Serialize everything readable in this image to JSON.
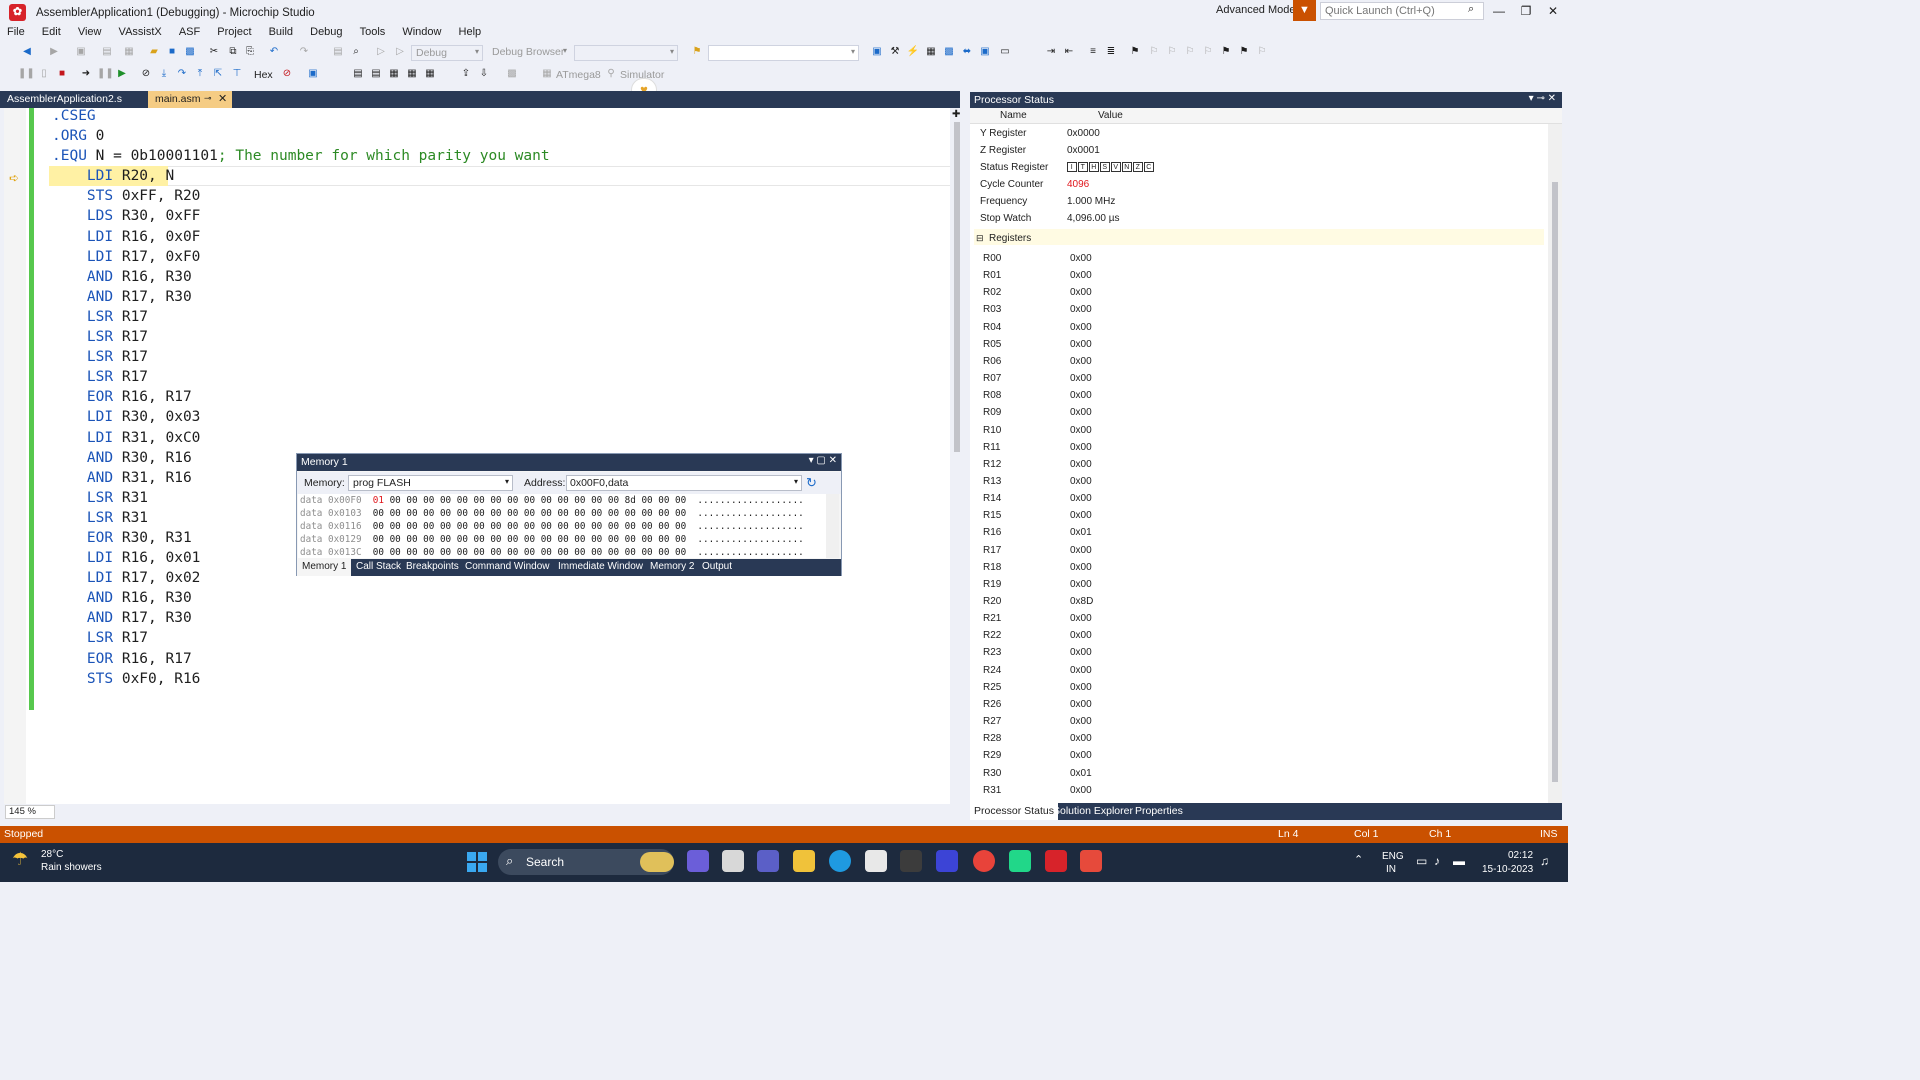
{
  "window": {
    "title": "AssemblerApplication1 (Debugging) - Microchip Studio",
    "advanced_mode": "Advanced Mode",
    "quick_launch_placeholder": "Quick Launch (Ctrl+Q)"
  },
  "menu": [
    "File",
    "Edit",
    "View",
    "VAssistX",
    "ASF",
    "Project",
    "Build",
    "Debug",
    "Tools",
    "Window",
    "Help"
  ],
  "toolbar": {
    "config_dropdown": "Debug",
    "browser_dropdown": "Debug Browser",
    "hex_label": "Hex",
    "device_label": "ATmega8",
    "tool_label": "Simulator"
  },
  "tabs": {
    "file1": "AssemblerApplication2.s",
    "file2": "main.asm"
  },
  "editor": {
    "zoom": "145 %",
    "lines": [
      {
        "kw": ".CSEG",
        "rest": "",
        "comment": ""
      },
      {
        "kw": ".ORG",
        "rest": " 0",
        "comment": ""
      },
      {
        "kw": ".EQU",
        "rest": " N = 0b10001101",
        "comment": "; The number for which parity you want"
      },
      {
        "kw": "    LDI",
        "rest": " R20, N",
        "comment": ""
      },
      {
        "kw": "    STS",
        "rest": " 0xFF, R20",
        "comment": ""
      },
      {
        "kw": "    LDS",
        "rest": " R30, 0xFF",
        "comment": ""
      },
      {
        "kw": "    LDI",
        "rest": " R16, 0x0F",
        "comment": ""
      },
      {
        "kw": "    LDI",
        "rest": " R17, 0xF0",
        "comment": ""
      },
      {
        "kw": "    AND",
        "rest": " R16, R30",
        "comment": ""
      },
      {
        "kw": "    AND",
        "rest": " R17, R30",
        "comment": ""
      },
      {
        "kw": "    LSR",
        "rest": " R17",
        "comment": ""
      },
      {
        "kw": "    LSR",
        "rest": " R17",
        "comment": ""
      },
      {
        "kw": "    LSR",
        "rest": " R17",
        "comment": ""
      },
      {
        "kw": "    LSR",
        "rest": " R17",
        "comment": ""
      },
      {
        "kw": "    EOR",
        "rest": " R16, R17",
        "comment": ""
      },
      {
        "kw": "    LDI",
        "rest": " R30, 0x03",
        "comment": ""
      },
      {
        "kw": "    LDI",
        "rest": " R31, 0xC0",
        "comment": ""
      },
      {
        "kw": "    AND",
        "rest": " R30, R16",
        "comment": ""
      },
      {
        "kw": "    AND",
        "rest": " R31, R16",
        "comment": ""
      },
      {
        "kw": "    LSR",
        "rest": " R31",
        "comment": ""
      },
      {
        "kw": "    LSR",
        "rest": " R31",
        "comment": ""
      },
      {
        "kw": "    EOR",
        "rest": " R30, R31",
        "comment": ""
      },
      {
        "kw": "    LDI",
        "rest": " R16, 0x01",
        "comment": ""
      },
      {
        "kw": "    LDI",
        "rest": " R17, 0x02",
        "comment": ""
      },
      {
        "kw": "    AND",
        "rest": " R16, R30",
        "comment": ""
      },
      {
        "kw": "    AND",
        "rest": " R17, R30",
        "comment": ""
      },
      {
        "kw": "    LSR",
        "rest": " R17",
        "comment": ""
      },
      {
        "kw": "    EOR",
        "rest": " R16, R17",
        "comment": ""
      },
      {
        "kw": "    STS",
        "rest": " 0xF0, R16",
        "comment": ""
      }
    ]
  },
  "memory": {
    "title": "Memory 1",
    "memory_label": "Memory:",
    "memory_value": "prog FLASH",
    "address_label": "Address:",
    "address_value": "0x00F0,data",
    "rows": [
      {
        "addr": "data 0x00F0",
        "first": "01",
        "rest": " 00 00 00 00 00 00 00 00 00 00 00 00 00 00 8d 00 00 00",
        "ascii": "  ..................."
      },
      {
        "addr": "data 0x0103",
        "first": "00",
        "rest": " 00 00 00 00 00 00 00 00 00 00 00 00 00 00 00 00 00 00",
        "ascii": "  ..................."
      },
      {
        "addr": "data 0x0116",
        "first": "00",
        "rest": " 00 00 00 00 00 00 00 00 00 00 00 00 00 00 00 00 00 00",
        "ascii": "  ..................."
      },
      {
        "addr": "data 0x0129",
        "first": "00",
        "rest": " 00 00 00 00 00 00 00 00 00 00 00 00 00 00 00 00 00 00",
        "ascii": "  ..................."
      },
      {
        "addr": "data 0x013C",
        "first": "00",
        "rest": " 00 00 00 00 00 00 00 00 00 00 00 00 00 00 00 00 00 00",
        "ascii": "  ..................."
      }
    ],
    "tabs": [
      "Memory 1",
      "Call Stack",
      "Breakpoints",
      "Command Window",
      "Immediate Window",
      "Memory 2",
      "Output"
    ]
  },
  "processor": {
    "title": "Processor Status",
    "col_name": "Name",
    "col_value": "Value",
    "rows": [
      {
        "name": "Y Register",
        "value": "0x0000"
      },
      {
        "name": "Z Register",
        "value": "0x0001"
      },
      {
        "name": "Status Register",
        "value": ""
      },
      {
        "name": "Cycle Counter",
        "value": "4096"
      },
      {
        "name": "Frequency",
        "value": "1.000 MHz"
      },
      {
        "name": "Stop Watch",
        "value": "4,096.00 µs"
      }
    ],
    "status_bits": [
      "I",
      "T",
      "H",
      "S",
      "V",
      "N",
      "Z",
      "C"
    ],
    "registers_label": "Registers",
    "registers": [
      {
        "name": "R00",
        "value": "0x00"
      },
      {
        "name": "R01",
        "value": "0x00"
      },
      {
        "name": "R02",
        "value": "0x00"
      },
      {
        "name": "R03",
        "value": "0x00"
      },
      {
        "name": "R04",
        "value": "0x00"
      },
      {
        "name": "R05",
        "value": "0x00"
      },
      {
        "name": "R06",
        "value": "0x00"
      },
      {
        "name": "R07",
        "value": "0x00"
      },
      {
        "name": "R08",
        "value": "0x00"
      },
      {
        "name": "R09",
        "value": "0x00"
      },
      {
        "name": "R10",
        "value": "0x00"
      },
      {
        "name": "R11",
        "value": "0x00"
      },
      {
        "name": "R12",
        "value": "0x00"
      },
      {
        "name": "R13",
        "value": "0x00"
      },
      {
        "name": "R14",
        "value": "0x00"
      },
      {
        "name": "R15",
        "value": "0x00"
      },
      {
        "name": "R16",
        "value": "0x01"
      },
      {
        "name": "R17",
        "value": "0x00"
      },
      {
        "name": "R18",
        "value": "0x00"
      },
      {
        "name": "R19",
        "value": "0x00"
      },
      {
        "name": "R20",
        "value": "0x8D"
      },
      {
        "name": "R21",
        "value": "0x00"
      },
      {
        "name": "R22",
        "value": "0x00"
      },
      {
        "name": "R23",
        "value": "0x00"
      },
      {
        "name": "R24",
        "value": "0x00"
      },
      {
        "name": "R25",
        "value": "0x00"
      },
      {
        "name": "R26",
        "value": "0x00"
      },
      {
        "name": "R27",
        "value": "0x00"
      },
      {
        "name": "R28",
        "value": "0x00"
      },
      {
        "name": "R29",
        "value": "0x00"
      },
      {
        "name": "R30",
        "value": "0x01"
      },
      {
        "name": "R31",
        "value": "0x00"
      }
    ],
    "tabs": [
      "Processor Status",
      "Solution Explorer",
      "Properties"
    ]
  },
  "statusbar": {
    "state": "Stopped",
    "line": "Ln 4",
    "col": "Col 1",
    "ch": "Ch 1",
    "mode": "INS"
  },
  "taskbar": {
    "temp": "28°C",
    "weather": "Rain showers",
    "search": "Search",
    "lang1": "ENG",
    "lang2": "IN",
    "time": "02:12",
    "date": "15-10-2023"
  },
  "colors": {
    "accent": "#ca5100",
    "panel_header": "#293955",
    "active_tab": "#f5cc84",
    "keyword": "#1b54b8",
    "comment": "#2c8a24"
  }
}
